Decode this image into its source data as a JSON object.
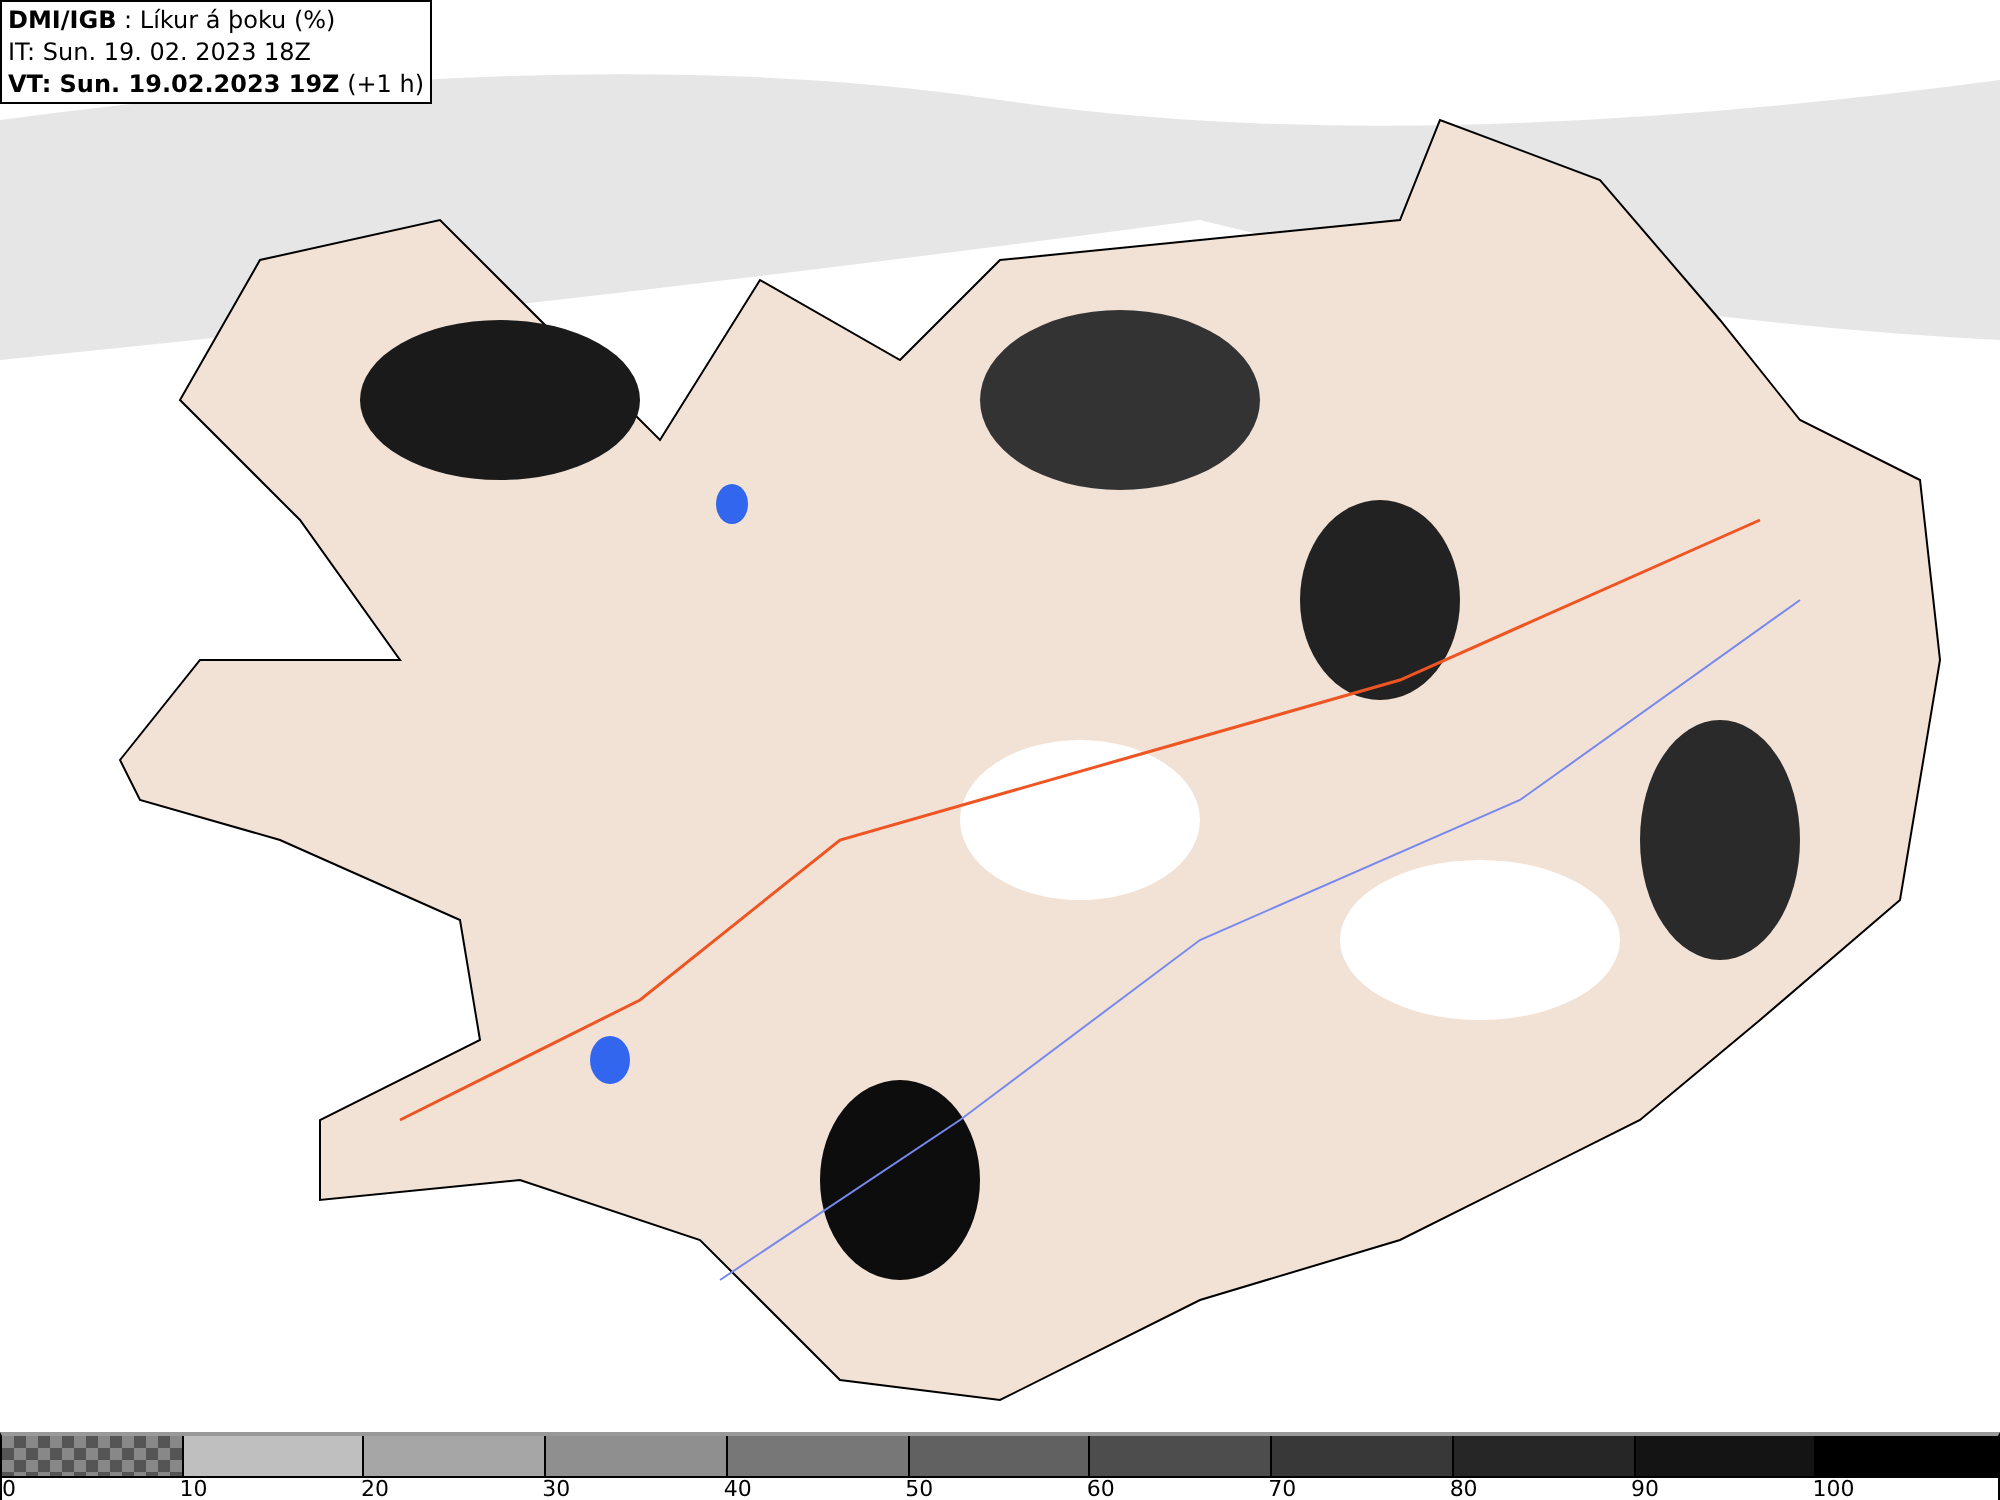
{
  "header": {
    "lines": [
      "**DMI/IGB** : Líkur á þoku (%)",
      "IT: Sun. 19. 02. 2023 18Z",
      "**VT: Sun. 19.02.2023 19Z** (+1 h)"
    ]
  },
  "legend": {
    "segments": [
      {
        "kind": "checker",
        "color": "#555555"
      },
      {
        "kind": "solid",
        "color": "#bfbfbf"
      },
      {
        "kind": "solid",
        "color": "#a6a6a6"
      },
      {
        "kind": "solid",
        "color": "#8f8f8f"
      },
      {
        "kind": "solid",
        "color": "#777777"
      },
      {
        "kind": "solid",
        "color": "#616161"
      },
      {
        "kind": "solid",
        "color": "#4d4d4d"
      },
      {
        "kind": "solid",
        "color": "#383838"
      },
      {
        "kind": "solid",
        "color": "#262626"
      },
      {
        "kind": "solid",
        "color": "#141414"
      },
      {
        "kind": "solid",
        "color": "#000000"
      }
    ],
    "labels": [
      "0",
      "10",
      "20",
      "30",
      "40",
      "50",
      "60",
      "70",
      "80",
      "90",
      "100"
    ]
  }
}
